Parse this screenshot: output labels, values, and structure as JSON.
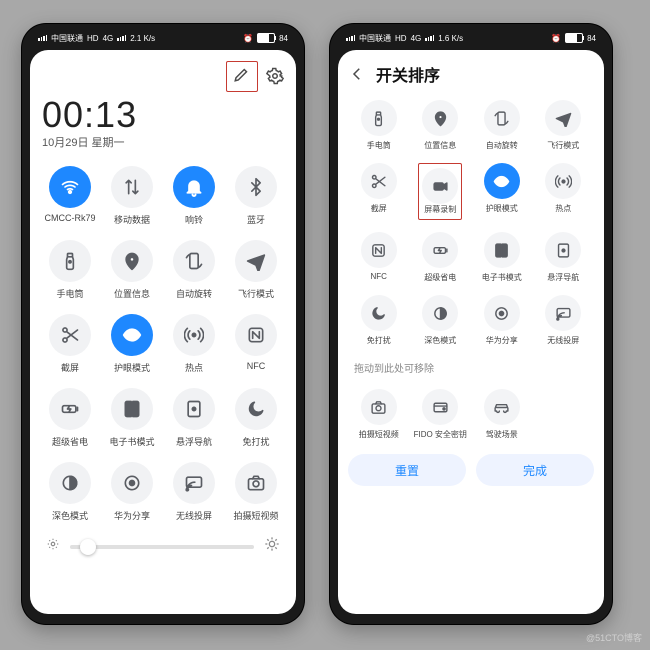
{
  "status": {
    "carrier": "中国联通",
    "net_badge": "HD",
    "net_gen": "4G",
    "speed_left": "2.1 K/s",
    "speed_right": "1.6 K/s",
    "battery_pct": "84"
  },
  "left": {
    "time": "00:13",
    "date": "10月29日 星期一",
    "icons": {
      "edit": "edit-icon",
      "settings": "gear-icon",
      "sun_low": "sun-low-icon",
      "sun_high": "sun-high-icon"
    },
    "toggles": [
      {
        "key": "wifi",
        "label": "CMCC-Rk79",
        "icon": "wifi",
        "on": true
      },
      {
        "key": "mobile-data",
        "label": "移动数据",
        "icon": "data-arrows",
        "on": false
      },
      {
        "key": "ringer",
        "label": "响铃",
        "icon": "bell",
        "on": true
      },
      {
        "key": "bluetooth",
        "label": "蓝牙",
        "icon": "bluetooth",
        "on": false
      },
      {
        "key": "flashlight",
        "label": "手电筒",
        "icon": "flashlight",
        "on": false
      },
      {
        "key": "location",
        "label": "位置信息",
        "icon": "pin",
        "on": false
      },
      {
        "key": "autorotate",
        "label": "自动旋转",
        "icon": "rotate",
        "on": false
      },
      {
        "key": "airplane",
        "label": "飞行模式",
        "icon": "airplane",
        "on": false
      },
      {
        "key": "screenshot",
        "label": "截屏",
        "icon": "scissors",
        "on": false
      },
      {
        "key": "eyecare",
        "label": "护眼模式",
        "icon": "eye",
        "on": true
      },
      {
        "key": "hotspot",
        "label": "热点",
        "icon": "hotspot",
        "on": false
      },
      {
        "key": "nfc",
        "label": "NFC",
        "icon": "nfc",
        "on": false
      },
      {
        "key": "powersave",
        "label": "超级省电",
        "icon": "battery-bolt",
        "on": false
      },
      {
        "key": "ebook",
        "label": "电子书模式",
        "icon": "book",
        "on": false
      },
      {
        "key": "dnd-nav",
        "label": "悬浮导航",
        "icon": "float-nav",
        "on": false
      },
      {
        "key": "dnd",
        "label": "免打扰",
        "icon": "moon",
        "on": false
      },
      {
        "key": "dark",
        "label": "深色模式",
        "icon": "dark",
        "on": false
      },
      {
        "key": "share",
        "label": "华为分享",
        "icon": "share",
        "on": false
      },
      {
        "key": "cast",
        "label": "无线投屏",
        "icon": "cast",
        "on": false
      },
      {
        "key": "record",
        "label": "拍摄短视频",
        "icon": "camera",
        "on": false
      }
    ]
  },
  "right": {
    "title": "开关排序",
    "hint": "拖动到此处可移除",
    "reset": "重置",
    "done": "完成",
    "toggles": [
      {
        "key": "flashlight",
        "label": "手电筒",
        "icon": "flashlight",
        "on": false
      },
      {
        "key": "location",
        "label": "位置信息",
        "icon": "pin",
        "on": false
      },
      {
        "key": "autorotate",
        "label": "自动旋转",
        "icon": "rotate",
        "on": false
      },
      {
        "key": "airplane",
        "label": "飞行模式",
        "icon": "airplane",
        "on": false
      },
      {
        "key": "screenshot",
        "label": "截屏",
        "icon": "scissors",
        "on": false
      },
      {
        "key": "screenrec",
        "label": "屏幕录制",
        "icon": "video",
        "on": false,
        "highlight": true
      },
      {
        "key": "eyecare",
        "label": "护眼模式",
        "icon": "eye",
        "on": true
      },
      {
        "key": "hotspot",
        "label": "热点",
        "icon": "hotspot",
        "on": false
      },
      {
        "key": "nfc",
        "label": "NFC",
        "icon": "nfc",
        "on": false
      },
      {
        "key": "powersave",
        "label": "超级省电",
        "icon": "battery-bolt",
        "on": false
      },
      {
        "key": "ebook",
        "label": "电子书模式",
        "icon": "book",
        "on": false
      },
      {
        "key": "dnd-nav",
        "label": "悬浮导航",
        "icon": "float-nav",
        "on": false
      },
      {
        "key": "dnd",
        "label": "免打扰",
        "icon": "moon",
        "on": false
      },
      {
        "key": "dark",
        "label": "深色模式",
        "icon": "dark",
        "on": false
      },
      {
        "key": "share",
        "label": "华为分享",
        "icon": "share",
        "on": false
      },
      {
        "key": "cast",
        "label": "无线投屏",
        "icon": "cast",
        "on": false
      }
    ],
    "removed": [
      {
        "key": "camera",
        "label": "拍摄短视频",
        "icon": "camera"
      },
      {
        "key": "fido",
        "label": "FIDO 安全密钥",
        "icon": "card"
      },
      {
        "key": "driving",
        "label": "驾驶场景",
        "icon": "car"
      }
    ]
  },
  "watermark": "@51CTO博客",
  "colors": {
    "accent": "#1e88ff",
    "highlight": "#c63a31"
  }
}
